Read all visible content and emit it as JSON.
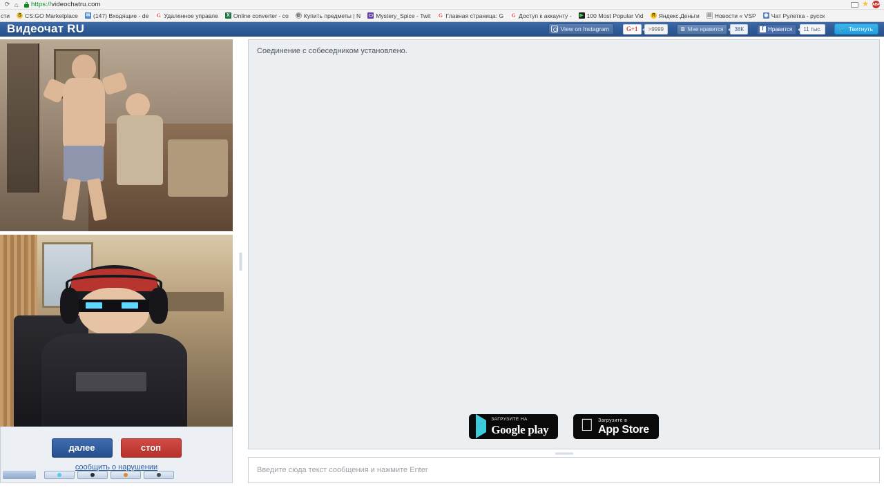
{
  "browser": {
    "url_scheme": "https://",
    "url_host": "videochatru.com",
    "reload_icon": "reload-icon",
    "home_icon": "home-icon",
    "lock_icon": "lock-icon",
    "cast_icon": "cast-icon",
    "bookmark_star_icon": "star-icon",
    "adblock_label": "ABP",
    "bookmarks_overflow": "сти",
    "bookmarks": [
      {
        "label": "CS:GO Marketplace",
        "icon": "steam-icon",
        "icon_class": "ico-steam",
        "glyph": "S"
      },
      {
        "label": "(147) Входящие - de",
        "icon": "mail-icon",
        "icon_class": "ico-mail",
        "glyph": "✉"
      },
      {
        "label": "Удаленное управле",
        "icon": "google-icon",
        "icon_class": "ico-google",
        "glyph": "G"
      },
      {
        "label": "Online converter - co",
        "icon": "excel-icon",
        "icon_class": "ico-excel",
        "glyph": "X"
      },
      {
        "label": "Купить предметы | N",
        "icon": "globe-icon",
        "icon_class": "ico-globe",
        "glyph": "◍"
      },
      {
        "label": "Mystery_Spice - Twit",
        "icon": "twitch-icon",
        "icon_class": "ico-twitch",
        "glyph": "▭"
      },
      {
        "label": "Главная страница: G",
        "icon": "google-icon",
        "icon_class": "ico-google",
        "glyph": "G"
      },
      {
        "label": "Доступ к аккаунту -",
        "icon": "google-icon",
        "icon_class": "ico-google",
        "glyph": "G"
      },
      {
        "label": "100 Most Popular Vid",
        "icon": "video-icon",
        "icon_class": "ico-video",
        "glyph": "▶"
      },
      {
        "label": "Яндекс.Деньги",
        "icon": "yandex-money-icon",
        "icon_class": "ico-yandex",
        "glyph": "Я"
      },
      {
        "label": "Новости « VSP",
        "icon": "document-icon",
        "icon_class": "ico-doc",
        "glyph": "▤"
      },
      {
        "label": "Чат Рулетка - русск",
        "icon": "chat-roulette-icon",
        "icon_class": "ico-chat",
        "glyph": "◉"
      }
    ]
  },
  "site": {
    "brand": "Видеочат RU",
    "brand_color": "#2f5c99",
    "social": {
      "instagram_label": "View on Instagram",
      "instagram_icon": "instagram-icon",
      "gplus_label": "G+1",
      "gplus_count": ">9999",
      "vk_letter": "B",
      "vk_label": "Мне нравится",
      "vk_count": "38К",
      "facebook_letter": "f",
      "facebook_label": "Нравится",
      "facebook_count": "11 тыс.",
      "twitter_icon": "twitter-bird-icon",
      "twitter_label": "Твитнуть"
    }
  },
  "video": {
    "remote_name": "remote-video",
    "local_name": "local-video"
  },
  "controls": {
    "next_label": "далее",
    "stop_label": "стоп",
    "report_label": "сообщить о нарушении",
    "next_color": "#2b5795",
    "stop_color": "#bf3a32"
  },
  "chat": {
    "system_message": "Соединение с собеседником установлено.",
    "input_placeholder": "Введите сюда текст сообщения и нажмите Enter"
  },
  "store_badges": [
    {
      "name": "google-play-badge",
      "small": "ЗАГРУЗИТЕ НА",
      "big": "Google play",
      "icon": "google-play-triangle-icon"
    },
    {
      "name": "app-store-badge",
      "small": "Загрузите в",
      "big": "App Store",
      "icon": "apple-logo-icon"
    }
  ],
  "taskbar": {
    "items": [
      "taskbar-item-1",
      "taskbar-item-2",
      "taskbar-item-3",
      "taskbar-item-4"
    ]
  }
}
